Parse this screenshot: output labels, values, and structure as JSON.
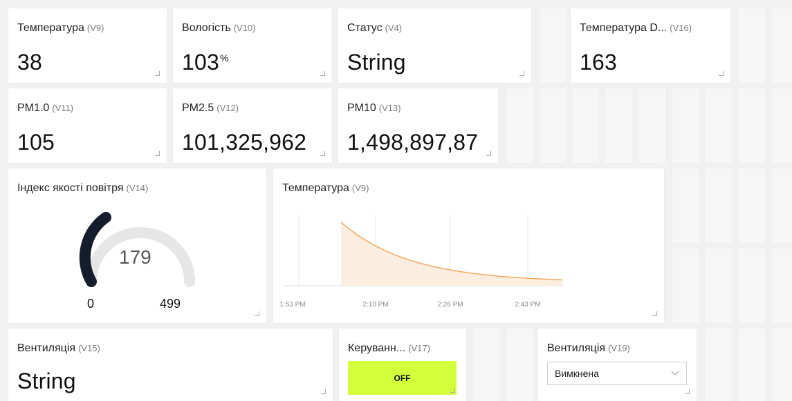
{
  "widgets": {
    "temp": {
      "label": "Температура",
      "pin": "(V9)",
      "value": "38"
    },
    "hum": {
      "label": "Вологість",
      "pin": "(V10)",
      "value": "103",
      "unit": "%"
    },
    "status": {
      "label": "Статус",
      "pin": "(V4)",
      "value": "String"
    },
    "temp_d": {
      "label": "Температура D...",
      "pin": "(V16)",
      "value": "163"
    },
    "pm1": {
      "label": "PM1.0",
      "pin": "(V11)",
      "value": "105"
    },
    "pm25": {
      "label": "PM2.5",
      "pin": "(V12)",
      "value": "101,325,962"
    },
    "pm10": {
      "label": "PM10",
      "pin": "(V13)",
      "value": "1,498,897,87"
    },
    "aqi": {
      "label": "Індекс якості повітря",
      "pin": "(V14)",
      "value": "179",
      "min": "0",
      "max": "499"
    },
    "chart": {
      "label": "Температура",
      "pin": "(V9)"
    },
    "vent": {
      "label": "Вентиляція",
      "pin": "(V15)",
      "value": "String"
    },
    "control": {
      "label": "Керуванн...",
      "pin": "(V17)",
      "state": "OFF"
    },
    "vent2": {
      "label": "Вентиляція",
      "pin": "(V19)",
      "selected": "Вимкнена"
    }
  },
  "chart_data": {
    "type": "area",
    "x": [
      "1:53 PM",
      "2:10 PM",
      "2:26 PM",
      "2:43 PM"
    ],
    "series": [
      {
        "values": [
          null,
          100,
          55,
          30,
          20
        ]
      }
    ],
    "color": "#f5a85a",
    "fill": "#fbeee0"
  },
  "colors": {
    "gauge": "#151c2c",
    "gauge_track": "#e6e6e6",
    "switch": "#d4ff3b"
  }
}
